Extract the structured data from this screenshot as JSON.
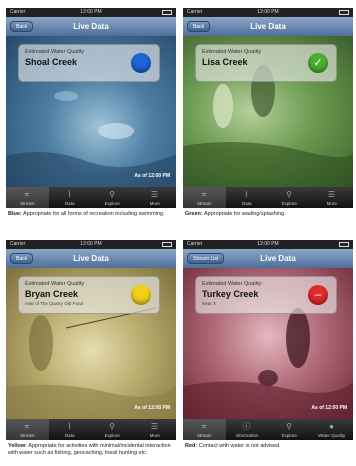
{
  "panels": [
    {
      "status": {
        "carrier": "Carrier",
        "time": "12:00 PM"
      },
      "nav": {
        "title": "Live Data",
        "back": "Back"
      },
      "card": {
        "estimated": "Estimated Water Quality",
        "creek": "Shoal Creek",
        "near": ""
      },
      "badge_color": "#1f63d6",
      "asof": "As of 12:00 PM",
      "tabs": [
        "Stream",
        "Data",
        "Explore",
        "More"
      ],
      "caption_label": "Blue:",
      "caption_text": "Appropriate for all forms of recreation including swimming.",
      "tint": "#3d6e9a"
    },
    {
      "status": {
        "carrier": "Carrier",
        "time": "12:00 PM"
      },
      "nav": {
        "title": "Live Data",
        "back": "Back"
      },
      "card": {
        "estimated": "Estimated Water Quality",
        "creek": "Lisa Creek",
        "near": ""
      },
      "badge_color": "#4caf2f",
      "asof": "",
      "tabs": [
        "Stream",
        "Data",
        "Explore",
        "More"
      ],
      "caption_label": "Green:",
      "caption_text": "Appropriate for wading/splashing.",
      "tint": "#5a8a3c"
    },
    {
      "status": {
        "carrier": "Carrier",
        "time": "12:00 PM"
      },
      "nav": {
        "title": "Live Data",
        "back": "Back"
      },
      "card": {
        "estimated": "Estimated Water Quality",
        "creek": "Bryan Creek",
        "near": "near of The Quarry Old Pond"
      },
      "badge_color": "#f2d019",
      "asof": "As of 12:00 PM",
      "tabs": [
        "Stream",
        "Data",
        "Explore",
        "More"
      ],
      "caption_label": "Yellow:",
      "caption_text": "Appropriate for activities with minimal/incidental interaction with water such as fishing, geocaching, fossil hunting etc.",
      "tint": "#a89a55"
    },
    {
      "status": {
        "carrier": "Carrier",
        "time": "12:00 PM"
      },
      "nav": {
        "title": "Live Data",
        "back": "Stream List"
      },
      "card": {
        "estimated": "Estimated Water Quality:",
        "creek": "Turkey Creek",
        "near": "Near X"
      },
      "badge_color": "#e22a2a",
      "asof": "As of 12:00 PM",
      "tabs": [
        "Stream",
        "Information",
        "Explore",
        "Water Quality"
      ],
      "caption_label": "Red:",
      "caption_text": "Contact with water is not advised.",
      "tint": "#8a3a48"
    }
  ]
}
